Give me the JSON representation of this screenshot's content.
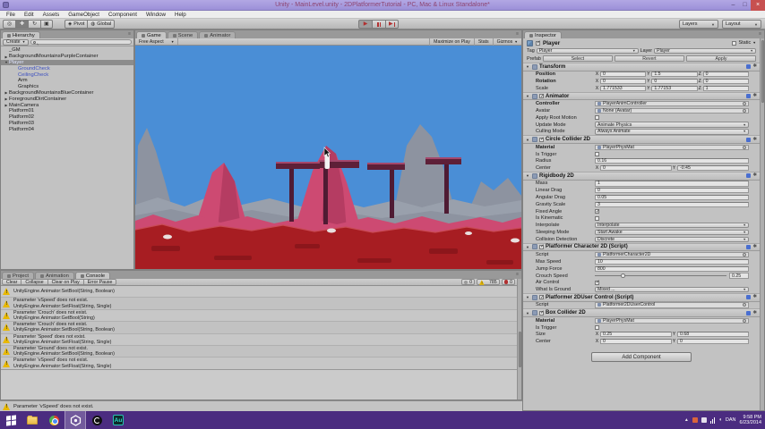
{
  "window": {
    "title": "Unity - MainLevel.unity - 2DPlatformerTutorial - PC, Mac & Linux Standalone*",
    "controls": {
      "minimize": "–",
      "maximize": "□",
      "close": "×"
    }
  },
  "menu": {
    "items": [
      "File",
      "Edit",
      "Assets",
      "GameObject",
      "Component",
      "Window",
      "Help"
    ]
  },
  "toolbar": {
    "pivot": "Pivot",
    "global": "Global",
    "layers": "Layers",
    "layout": "Layout"
  },
  "hierarchy": {
    "tab": "Hierarchy",
    "create": "Create",
    "items": [
      {
        "label": "_GM",
        "indent": 0,
        "fold": "none",
        "style": "normal"
      },
      {
        "label": "BackgroundMountainsPurpleContainer",
        "indent": 0,
        "fold": "closed",
        "style": "normal"
      },
      {
        "label": "Player",
        "indent": 0,
        "fold": "open",
        "style": "selected"
      },
      {
        "label": "GroundCheck",
        "indent": 1,
        "fold": "none",
        "style": "blue"
      },
      {
        "label": "CeilingCheck",
        "indent": 1,
        "fold": "none",
        "style": "blue"
      },
      {
        "label": "Arm",
        "indent": 1,
        "fold": "none",
        "style": "normal"
      },
      {
        "label": "Graphics",
        "indent": 1,
        "fold": "none",
        "style": "normal"
      },
      {
        "label": "BackgroundMountainsBlueContainer",
        "indent": 0,
        "fold": "closed",
        "style": "normal"
      },
      {
        "label": "ForegroundDirtContainer",
        "indent": 0,
        "fold": "closed",
        "style": "normal"
      },
      {
        "label": "MainCamera",
        "indent": 0,
        "fold": "closed",
        "style": "normal"
      },
      {
        "label": "Platform01",
        "indent": 0,
        "fold": "none",
        "style": "normal"
      },
      {
        "label": "Platform02",
        "indent": 0,
        "fold": "none",
        "style": "normal"
      },
      {
        "label": "Platform03",
        "indent": 0,
        "fold": "none",
        "style": "normal"
      },
      {
        "label": "Platform04",
        "indent": 0,
        "fold": "none",
        "style": "normal"
      }
    ]
  },
  "game_view": {
    "tabs": [
      "Game",
      "Scene",
      "Animator"
    ],
    "active_tab": "Game",
    "aspect": "Free Aspect",
    "maximize_on_play": "Maximize on Play",
    "stats": "Stats",
    "gizmos": "Gizmos",
    "scene_colors": {
      "sky": "#4a8ed6",
      "mountains_gray": "#8d93a0",
      "mountains_gray_light": "#99a0ac",
      "mountains_pink": "#cd4a72",
      "mountains_pink_dark": "#b53c62",
      "ground": "#a71d22",
      "ground_dark": "#8c161b",
      "platform": "#5e2038",
      "platform_post": "#4f1b33",
      "platform_highlight": "#a4486c",
      "player": "#f2f2f2"
    }
  },
  "inspector": {
    "tab": "Inspector",
    "header": {
      "name": "Player",
      "static": "Static"
    },
    "tag_label": "Tag",
    "tag_value": "Player",
    "layer_label": "Layer",
    "layer_value": "Player",
    "prefab_label": "Prefab",
    "prefab_buttons": [
      "Select",
      "Revert",
      "Apply"
    ],
    "add_component": "Add Component",
    "components": [
      {
        "name": "Transform",
        "checkbox": false,
        "rows": [
          {
            "label": "Position",
            "type": "vec3",
            "x": "0",
            "y": "1.5",
            "z": "0",
            "bold": true
          },
          {
            "label": "Rotation",
            "type": "vec3",
            "x": "0",
            "y": "0",
            "z": "0",
            "bold": true
          },
          {
            "label": "Scale",
            "type": "vec3",
            "x": "1.771533",
            "y": "1.77153",
            "z": "1",
            "bold": false
          }
        ]
      },
      {
        "name": "Animator",
        "checkbox": true,
        "checked": true,
        "rows": [
          {
            "label": "Controller",
            "type": "obj",
            "value": "PlayerAnimController",
            "bold": true
          },
          {
            "label": "Avatar",
            "type": "obj",
            "value": "None (Avatar)",
            "bold": false
          },
          {
            "label": "Apply Root Motion",
            "type": "check",
            "checked": false
          },
          {
            "label": "Update Mode",
            "type": "drop",
            "value": "Animate Physics"
          },
          {
            "label": "Culling Mode",
            "type": "drop",
            "value": "Always Animate"
          }
        ]
      },
      {
        "name": "Circle Collider 2D",
        "checkbox": true,
        "checked": true,
        "rows": [
          {
            "label": "Material",
            "type": "obj",
            "value": "PlayerPhysMat",
            "bold": true
          },
          {
            "label": "Is Trigger",
            "type": "check",
            "checked": false
          },
          {
            "label": "Radius",
            "type": "field",
            "value": "0.16"
          },
          {
            "label": "Center",
            "type": "vec2",
            "x": "0",
            "y": "-0.45"
          }
        ]
      },
      {
        "name": "Rigidbody 2D",
        "checkbox": false,
        "rows": [
          {
            "label": "Mass",
            "type": "field",
            "value": "1"
          },
          {
            "label": "Linear Drag",
            "type": "field",
            "value": "0"
          },
          {
            "label": "Angular Drag",
            "type": "field",
            "value": "0.05"
          },
          {
            "label": "Gravity Scale",
            "type": "field",
            "value": "3"
          },
          {
            "label": "Fixed Angle",
            "type": "check",
            "checked": true
          },
          {
            "label": "Is Kinematic",
            "type": "check",
            "checked": false
          },
          {
            "label": "Interpolate",
            "type": "drop",
            "value": "Interpolate"
          },
          {
            "label": "Sleeping Mode",
            "type": "drop",
            "value": "Start Awake"
          },
          {
            "label": "Collision Detection",
            "type": "drop",
            "value": "Discrete"
          }
        ]
      },
      {
        "name": "Platformer Character 2D (Script)",
        "checkbox": true,
        "checked": true,
        "rows": [
          {
            "label": "Script",
            "type": "obj",
            "value": "PlatformerCharacter2D",
            "bold": false
          },
          {
            "label": "Max Speed",
            "type": "field",
            "value": "10"
          },
          {
            "label": "Jump Force",
            "type": "field",
            "value": "800"
          },
          {
            "label": "Crouch Speed",
            "type": "slider",
            "value": "0.25"
          },
          {
            "label": "Air Control",
            "type": "check",
            "checked": true
          },
          {
            "label": "What Is Ground",
            "type": "drop",
            "value": "Mixed ..."
          }
        ]
      },
      {
        "name": "Platformer 2DUser Control (Script)",
        "checkbox": true,
        "checked": true,
        "rows": [
          {
            "label": "Script",
            "type": "obj",
            "value": "Platformer2DUserControl",
            "bold": false
          }
        ]
      },
      {
        "name": "Box Collider 2D",
        "checkbox": true,
        "checked": true,
        "rows": [
          {
            "label": "Material",
            "type": "obj",
            "value": "PlayerPhysMat",
            "bold": true
          },
          {
            "label": "Is Trigger",
            "type": "check",
            "checked": false
          },
          {
            "label": "Size",
            "type": "vec2",
            "x": "0.25",
            "y": "0.68"
          },
          {
            "label": "Center",
            "type": "vec2",
            "x": "0",
            "y": "0"
          }
        ]
      }
    ]
  },
  "console": {
    "tabs": [
      "Project",
      "Animation",
      "Console"
    ],
    "active_tab": "Console",
    "buttons": [
      "Clear",
      "Collapse",
      "Clear on Play",
      "Error Pause"
    ],
    "counts": {
      "info": "0",
      "warnings": "785",
      "errors": "0"
    },
    "entries": [
      {
        "lines": [
          "UnityEngine.Animator:SetBool(String, Boolean)"
        ]
      },
      {
        "lines": [
          "Parameter 'vSpeed' does not exist.",
          "UnityEngine.Animator:SetFloat(String, Single)"
        ]
      },
      {
        "lines": [
          "Parameter 'Crouch' does not exist.",
          "UnityEngine.Animator:GetBool(String)"
        ]
      },
      {
        "lines": [
          "Parameter 'Crouch' does not exist.",
          "UnityEngine.Animator:SetBool(String, Boolean)"
        ]
      },
      {
        "lines": [
          "Parameter 'Speed' does not exist.",
          "UnityEngine.Animator:SetFloat(String, Single)"
        ]
      },
      {
        "lines": [
          "Parameter 'Ground' does not exist.",
          "UnityEngine.Animator:SetBool(String, Boolean)"
        ]
      },
      {
        "lines": [
          "Parameter 'vSpeed' does not exist.",
          "UnityEngine.Animator:SetFloat(String, Single)"
        ]
      }
    ]
  },
  "status_bar": {
    "message": "Parameter 'vSpeed' does not exist."
  },
  "taskbar": {
    "language": "DAN",
    "time": "9:58 PM",
    "date": "6/23/2014"
  }
}
